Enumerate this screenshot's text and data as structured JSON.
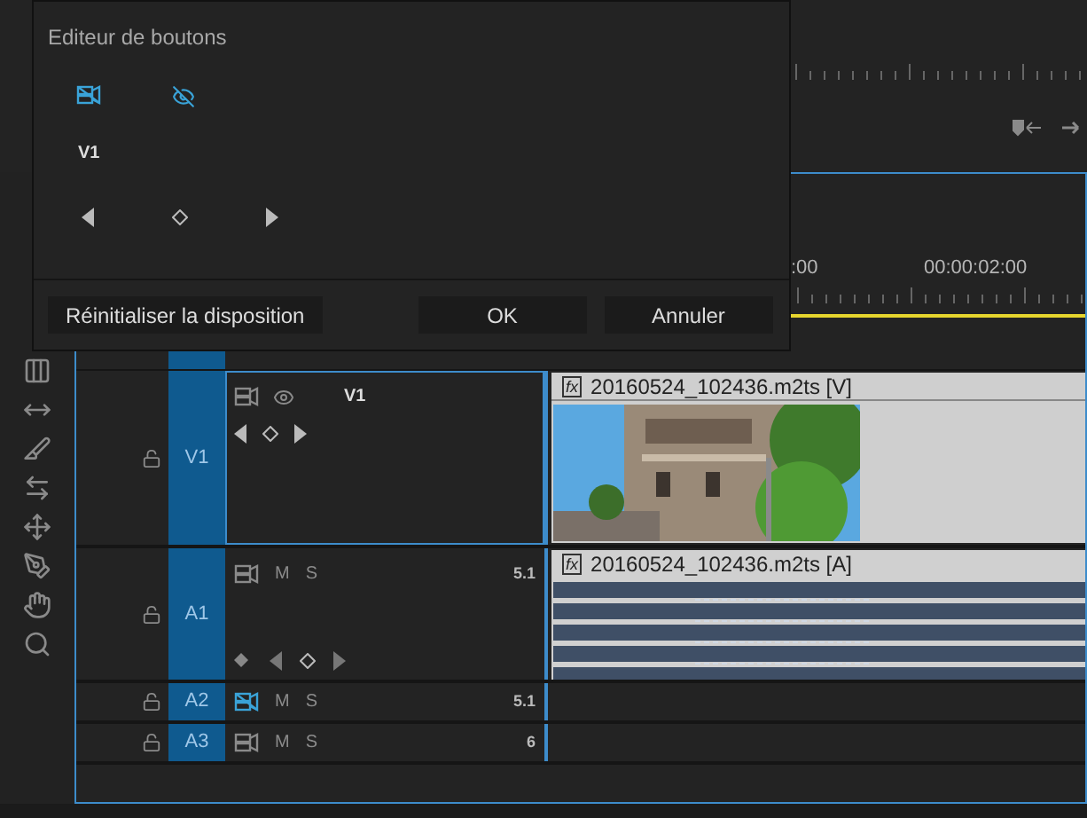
{
  "dialog": {
    "title": "Editeur de boutons",
    "track_label": "V1",
    "buttons": [
      {
        "label": "Réinitialiser la disposition",
        "kind": "wide"
      },
      {
        "label": "OK",
        "kind": "normal"
      },
      {
        "label": "Annuler",
        "kind": "normal"
      }
    ]
  },
  "timeline": {
    "timecodes": [
      ":00",
      "00:00:02:00"
    ],
    "tracks": [
      {
        "kind": "video",
        "name": "V1",
        "label": "V1",
        "selected": true,
        "clip": {
          "fx": "fx",
          "title": "20160524_102436.m2ts [V]"
        }
      },
      {
        "kind": "audio",
        "name": "A1",
        "mute": "M",
        "solo": "S",
        "channels": "5.1",
        "expanded": true,
        "output_off": false,
        "clip": {
          "fx": "fx",
          "title": "20160524_102436.m2ts [A]"
        }
      },
      {
        "kind": "audio",
        "name": "A2",
        "mute": "M",
        "solo": "S",
        "channels": "5.1",
        "expanded": false,
        "output_off": true
      },
      {
        "kind": "audio",
        "name": "A3",
        "mute": "M",
        "solo": "S",
        "channels": "6",
        "expanded": false,
        "output_off": false
      }
    ]
  }
}
